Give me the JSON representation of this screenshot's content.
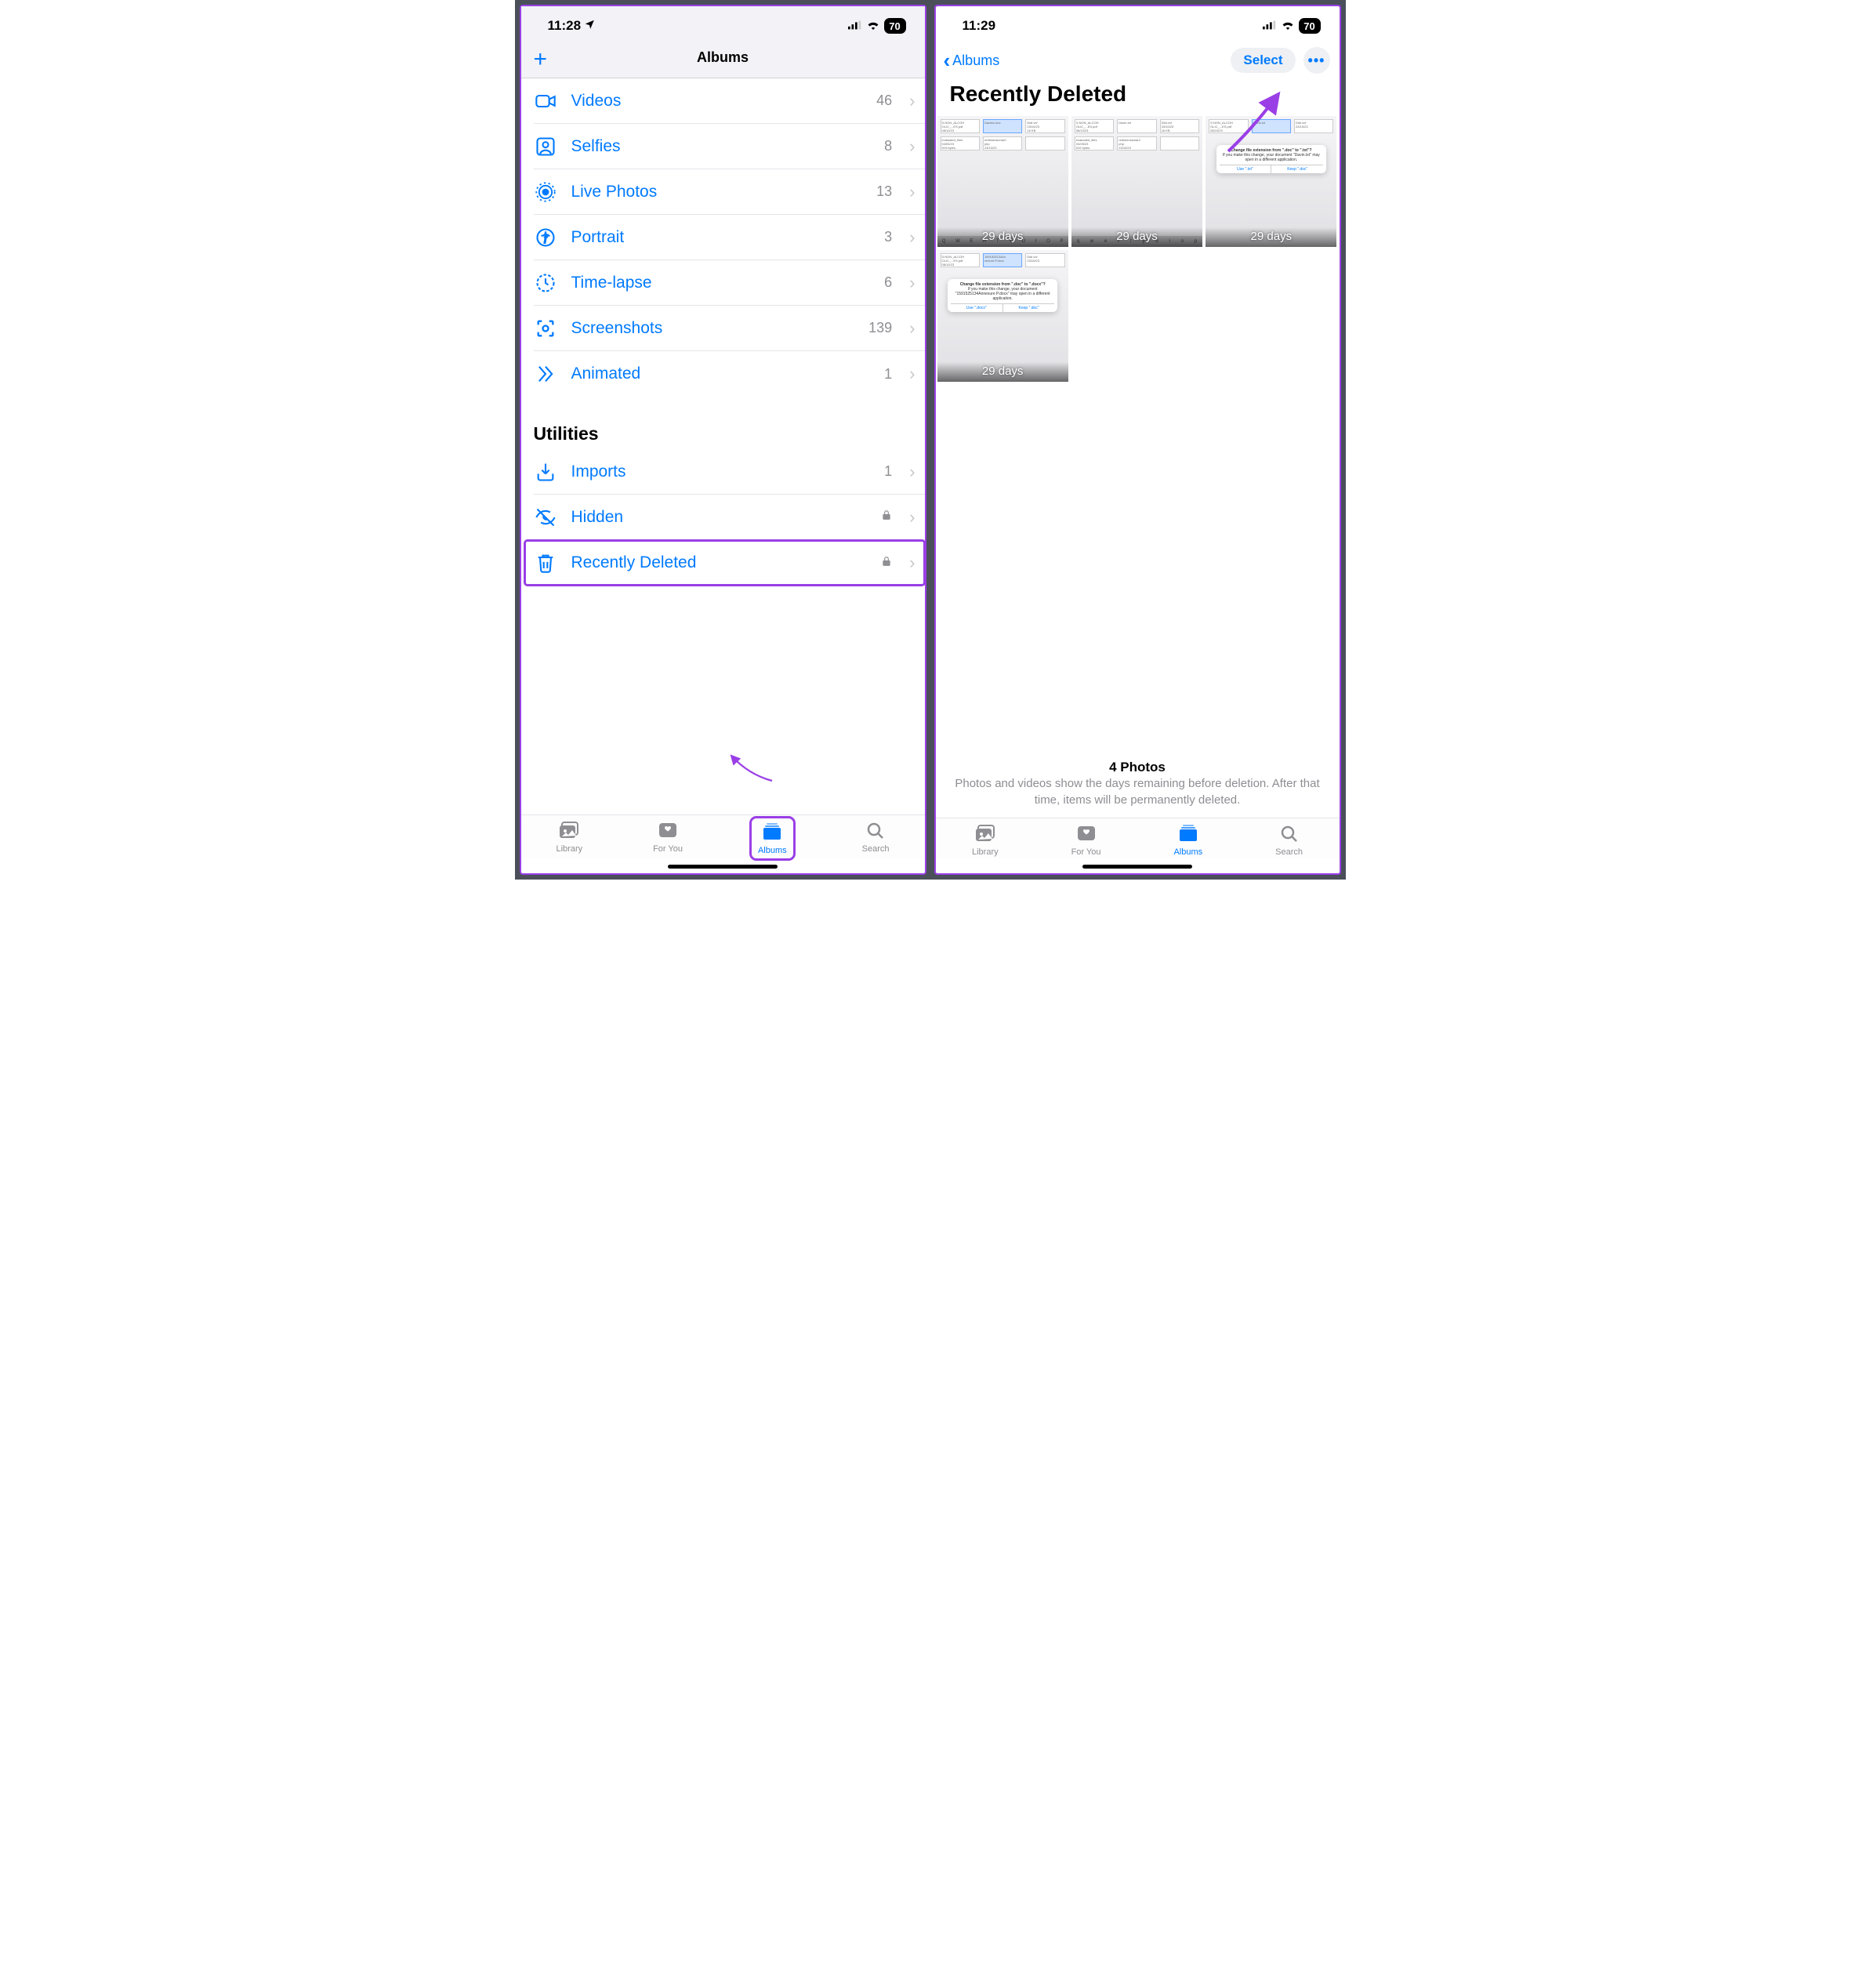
{
  "left": {
    "status": {
      "time": "11:28",
      "battery": "70"
    },
    "header": {
      "title": "Albums"
    },
    "media_types": [
      {
        "icon": "video",
        "label": "Videos",
        "count": "46"
      },
      {
        "icon": "selfie",
        "label": "Selfies",
        "count": "8"
      },
      {
        "icon": "live",
        "label": "Live Photos",
        "count": "13"
      },
      {
        "icon": "portrait",
        "label": "Portrait",
        "count": "3"
      },
      {
        "icon": "timelapse",
        "label": "Time-lapse",
        "count": "6"
      },
      {
        "icon": "screenshot",
        "label": "Screenshots",
        "count": "139"
      },
      {
        "icon": "animated",
        "label": "Animated",
        "count": "1"
      }
    ],
    "utilities_header": "Utilities",
    "utilities": [
      {
        "icon": "import",
        "label": "Imports",
        "count": "1",
        "locked": false
      },
      {
        "icon": "hidden",
        "label": "Hidden",
        "count": "",
        "locked": true
      },
      {
        "icon": "trash",
        "label": "Recently Deleted",
        "count": "",
        "locked": true
      }
    ],
    "tabs": [
      {
        "icon": "library",
        "label": "Library"
      },
      {
        "icon": "foryou",
        "label": "For You"
      },
      {
        "icon": "albums",
        "label": "Albums"
      },
      {
        "icon": "search",
        "label": "Search"
      }
    ],
    "active_tab": 2,
    "highlight_row": 2,
    "highlight_tab": 2
  },
  "right": {
    "status": {
      "time": "11:29",
      "battery": "70"
    },
    "back_label": "Albums",
    "select_label": "Select",
    "title": "Recently Deleted",
    "thumbs": [
      {
        "days": "29 days",
        "kind": "files_kbd"
      },
      {
        "days": "29 days",
        "kind": "files_kbd2"
      },
      {
        "days": "29 days",
        "kind": "dialog_txt"
      },
      {
        "days": "29 days",
        "kind": "dialog_docx"
      }
    ],
    "footer_count": "4 Photos",
    "footer_note": "Photos and videos show the days remaining before deletion. After that time, items will be permanently deleted.",
    "tabs": [
      {
        "icon": "library",
        "label": "Library"
      },
      {
        "icon": "foryou",
        "label": "For You"
      },
      {
        "icon": "albums",
        "label": "Albums"
      },
      {
        "icon": "search",
        "label": "Search"
      }
    ],
    "active_tab": 2
  }
}
